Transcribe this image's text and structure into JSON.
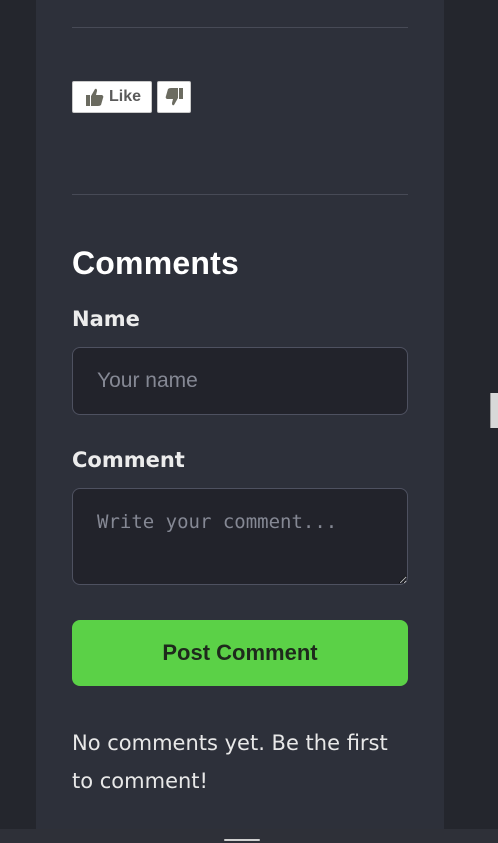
{
  "reactions": {
    "like_label": "Like",
    "like_icon": "thumbs-up-icon",
    "dislike_icon": "thumbs-down-icon"
  },
  "comments": {
    "title": "Comments",
    "name_label": "Name",
    "name_placeholder": "Your name",
    "comment_label": "Comment",
    "comment_placeholder": "Write your comment...",
    "submit_label": "Post Comment",
    "empty_message": "No comments yet. Be the first to comment!"
  },
  "colors": {
    "background": "#23252c",
    "card": "#2d303a",
    "accent_green": "#5bd147",
    "input_bg": "#22232b"
  }
}
